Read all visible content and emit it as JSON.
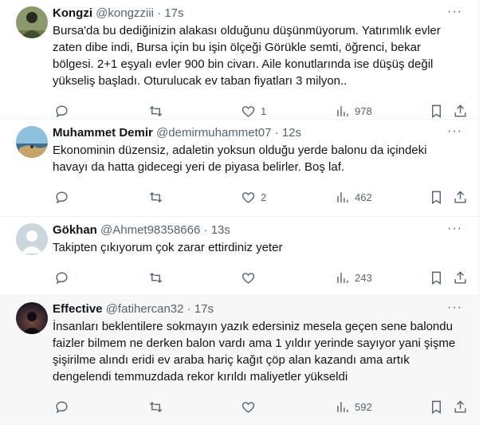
{
  "tweets": [
    {
      "name": "Kongzi",
      "handle": "@kongzziii",
      "time": "17s",
      "text": "Bursa'da bu dediğinizin alakası olduğunu düşünmüyorum. Yatırımlık evler\nzaten dibe indi, Bursa için bu işin ölçeği Görükle semti, öğrenci, bekar\nbölgesi. 2+1 eşyalı evler 900 bin civarı. Aile konutlarında ise düşüş değil\nyükseliş başladı. Oturulucak ev taban fiyatları 3 milyon..",
      "likes": "1",
      "views": "978",
      "avatar_color": "#4a5a3a"
    },
    {
      "name": "Muhammet Demir",
      "handle": "@demirmuhammet07",
      "time": "12s",
      "text": "Ekonominin düzensiz, adaletin yoksun olduğu yerde balonu da içindeki\nhavayı da hatta gidecegi yeri de piyasa belirler. Boş laf.",
      "likes": "2",
      "views": "462",
      "avatar_color": "#5a8bb0"
    },
    {
      "name": "Gökhan",
      "handle": "@Ahmet98358666",
      "time": "13s",
      "text": "Takipten çıkıyorum çok zarar ettirdiniz yeter",
      "likes": "",
      "views": "243",
      "avatar_color": "#ccd6dd"
    },
    {
      "name": "Effective",
      "handle": "@fatihercan32",
      "time": "17s",
      "text": "İnsanları beklentilere sokmayın yazık edersiniz mesela geçen sene balondu\nfaizler bilmem ne derken balon vardı ama 1 yıldır yerinde sayıyor yani şişme\nşişirilme alındı eridi ev araba hariç kağıt çöp alan kazandı ama artık\ndengelendi temmuzdada rekor kırıldı maliyetler yükseldi",
      "likes": "",
      "views": "592",
      "avatar_color": "#2a2438"
    }
  ],
  "ui": {
    "dot": "·",
    "more": "···"
  }
}
